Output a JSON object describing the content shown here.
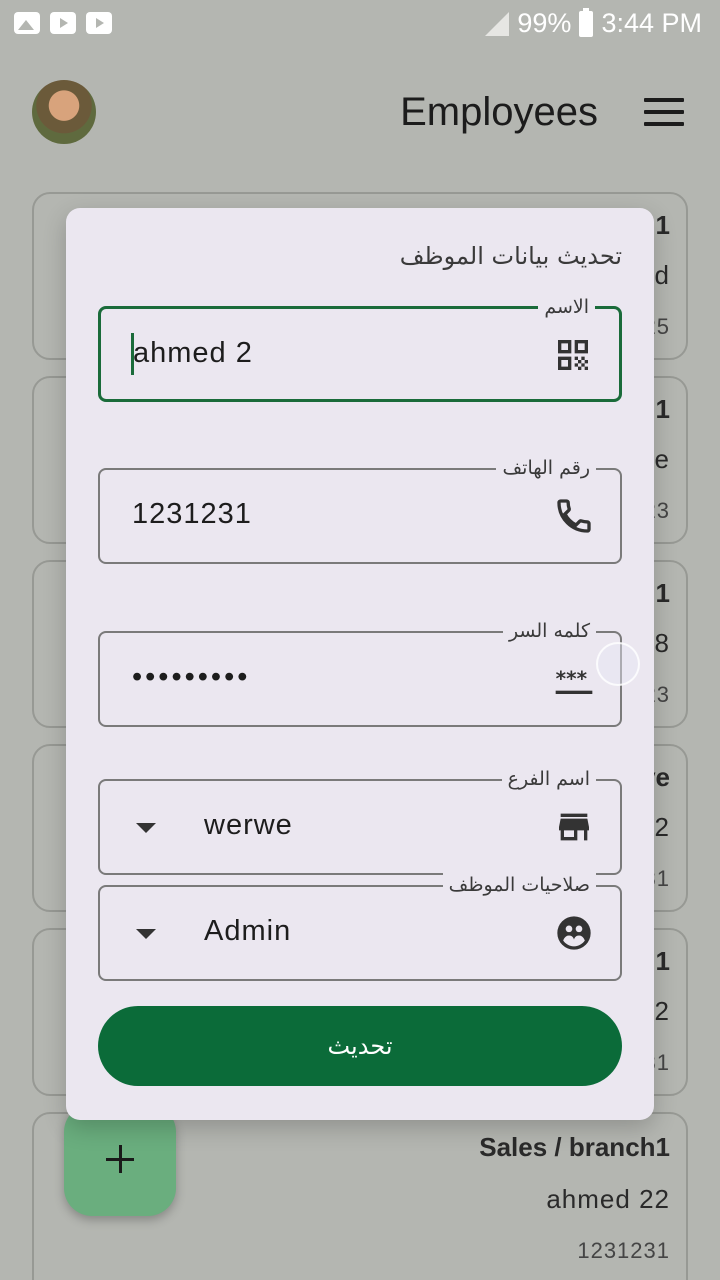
{
  "status_bar": {
    "battery": "99%",
    "time": "3:44 PM"
  },
  "app_bar": {
    "title": "Employees"
  },
  "background_cards": [
    {
      "line1": "n1",
      "line2": "d",
      "line3": "25"
    },
    {
      "line1": "n1",
      "line2": "e",
      "line3": "23"
    },
    {
      "line1": "n1",
      "line2": "8",
      "line3": "23"
    },
    {
      "line1": "ve",
      "line2": "22",
      "line3": "31"
    },
    {
      "line1": "n1",
      "line2": "2",
      "line3": "31"
    },
    {
      "line1": "Sales / branch1",
      "line2": "ahmed 22",
      "line3": "1231231"
    }
  ],
  "dialog": {
    "title": "تحديث بيانات الموظف",
    "fields": {
      "name": {
        "label": "الاسم",
        "value": "ahmed 2",
        "icon": "qr-code-icon"
      },
      "phone": {
        "label": "رقم الهاتف",
        "value": "1231231",
        "icon": "phone-icon"
      },
      "password": {
        "label": "كلمه السر",
        "value": "•••••••••",
        "icon": "password-icon"
      },
      "branch": {
        "label": "اسم الفرع",
        "value": "werwe",
        "icon": "store-icon"
      },
      "role": {
        "label": "صلاحيات الموظف",
        "value": "Admin",
        "icon": "group-icon"
      }
    },
    "update_button": "تحديث"
  },
  "colors": {
    "primary": "#0b6b39",
    "fab": "#6aae7e",
    "dialog_bg": "#ebe7f0",
    "scrim": "#b4b6b1"
  }
}
